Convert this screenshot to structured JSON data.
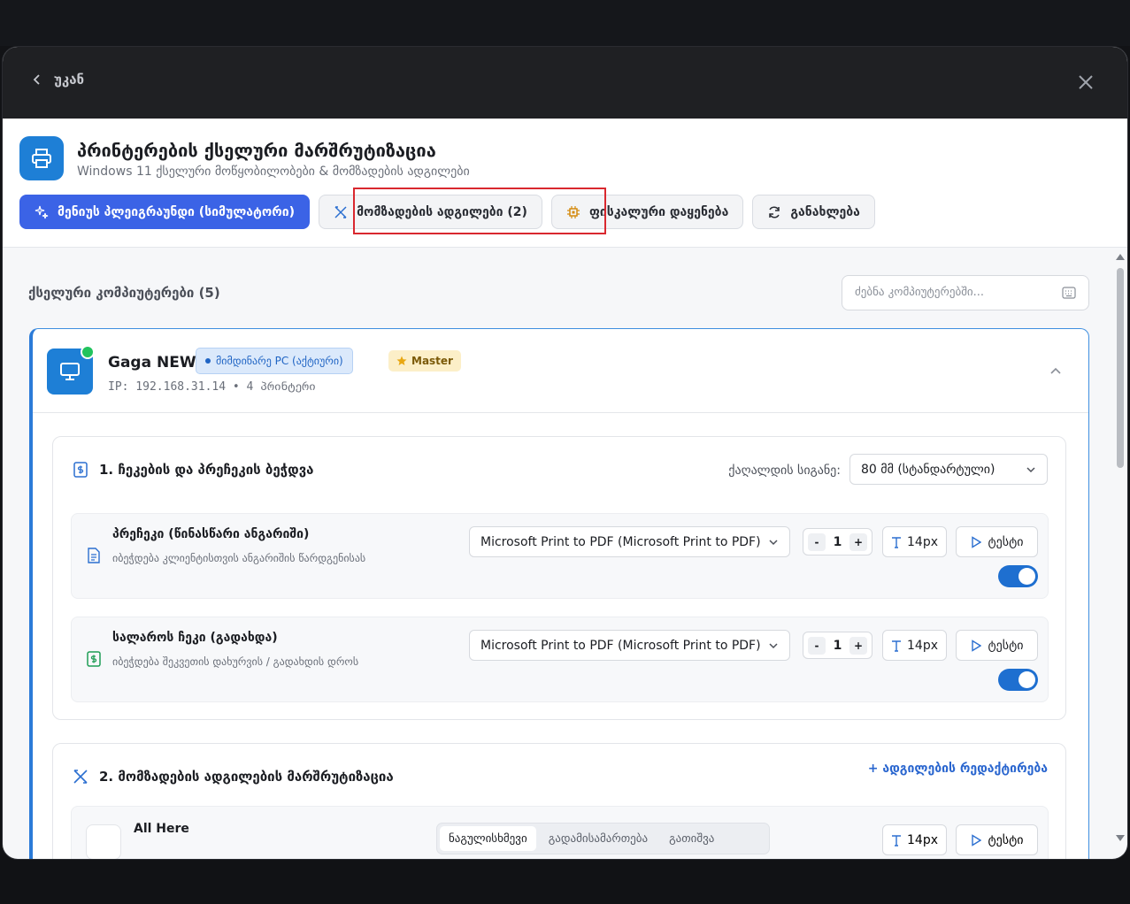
{
  "topbar": {
    "back_label": "უკან"
  },
  "header": {
    "title": "პრინტერების ქსელური მარშრუტიზაცია",
    "subtitle": "Windows 11 ქსელური მოწყობილობები & მომზადების ადგილები",
    "tabs": [
      {
        "label": "მენიუს პლეიგრაუნდი (სიმულატორი)",
        "icon": "sparkle-icon",
        "active": true
      },
      {
        "label": "მომზადების ადგილები (2)",
        "icon": "utensils-icon",
        "active": false
      },
      {
        "label": "ფისკალური დაყენება",
        "icon": "chip-icon",
        "active": false
      },
      {
        "label": "განახლება",
        "icon": "refresh-icon",
        "active": false
      }
    ]
  },
  "content": {
    "section_title": "ქსელური კომპიუტერები (5)",
    "search_placeholder": "ძებნა კომპიუტერებში...",
    "pc": {
      "name": "Gaga NEW",
      "badge_current": "მიმდინარე PC (აქტიური)",
      "badge_master": "Master",
      "meta": "IP: 192.168.31.14 • 4 პრინტერი",
      "status_color": "#22c35e"
    },
    "receipts": {
      "title": "1. ჩეკების და პრეჩეკის ბეჭდვა",
      "paper_label": "ქაღალდის სიგანე:",
      "paper_value": "80 მმ (სტანდარტული)",
      "rows": [
        {
          "title": "პრეჩეკი (წინასწარი ანგარიში)",
          "desc": "იბეჭდება კლიენტისთვის ანგარიშის წარდგენისას",
          "printer": "Microsoft Print to PDF (Microsoft Print to PDF)",
          "copies": "1",
          "font": "14px",
          "test": "ტესტი",
          "enabled": true
        },
        {
          "title": "სალაროს ჩეკი (გადახდა)",
          "desc": "იბეჭდება შეკვეთის დახურვის / გადახდის დროს",
          "printer": "Microsoft Print to PDF (Microsoft Print to PDF)",
          "copies": "1",
          "font": "14px",
          "test": "ტესტი",
          "enabled": true
        }
      ]
    },
    "prep": {
      "title": "2. მომზადების ადგილების მარშრუტიზაცია",
      "edit_link": "+ ადგილების რედაქტირება",
      "row": {
        "title": "All Here",
        "segments": [
          "ნაგულისხმევი",
          "გადამისამართება",
          "გათიშვა"
        ],
        "font": "14px",
        "test": "ტესტი"
      }
    }
  },
  "colors": {
    "accent": "#3b63e6",
    "pc_accent": "#2b7bd8",
    "highlight": "#d9282f"
  }
}
